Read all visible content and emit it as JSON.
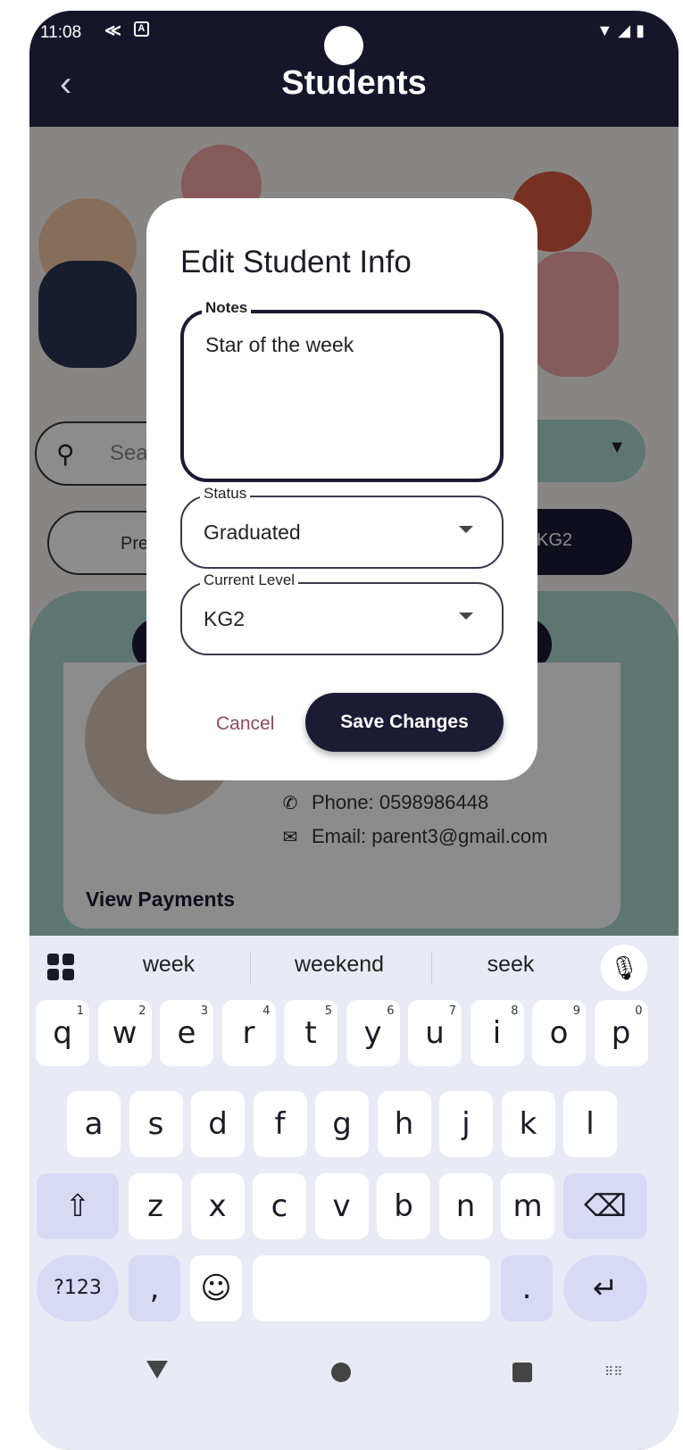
{
  "status_bar": {
    "time": "11:08"
  },
  "app_bar": {
    "back_icon": "‹",
    "title": "Students"
  },
  "background": {
    "search_placeholder": "Sea",
    "chip_left": "Pre",
    "chip_right": "KG2",
    "phone_line": "Phone: 0598986448",
    "email_line": "Email: parent3@gmail.com",
    "view_payments": "View Payments"
  },
  "dialog": {
    "title": "Edit Student Info",
    "notes": {
      "label": "Notes",
      "value": "Star of the week"
    },
    "status": {
      "label": "Status",
      "value": "Graduated"
    },
    "level": {
      "label": "Current Level",
      "value": "KG2"
    },
    "cancel_label": "Cancel",
    "save_label": "Save Changes"
  },
  "keyboard": {
    "suggestions": [
      "week",
      "weekend",
      "seek"
    ],
    "row1": [
      [
        "q",
        "1"
      ],
      [
        "w",
        "2"
      ],
      [
        "e",
        "3"
      ],
      [
        "r",
        "4"
      ],
      [
        "t",
        "5"
      ],
      [
        "y",
        "6"
      ],
      [
        "u",
        "7"
      ],
      [
        "i",
        "8"
      ],
      [
        "o",
        "9"
      ],
      [
        "p",
        "0"
      ]
    ],
    "row2": [
      "a",
      "s",
      "d",
      "f",
      "g",
      "h",
      "j",
      "k",
      "l"
    ],
    "row3": [
      "z",
      "x",
      "c",
      "v",
      "b",
      "n",
      "m"
    ],
    "symbols_key": "?123",
    "comma_key": ",",
    "period_key": "."
  }
}
